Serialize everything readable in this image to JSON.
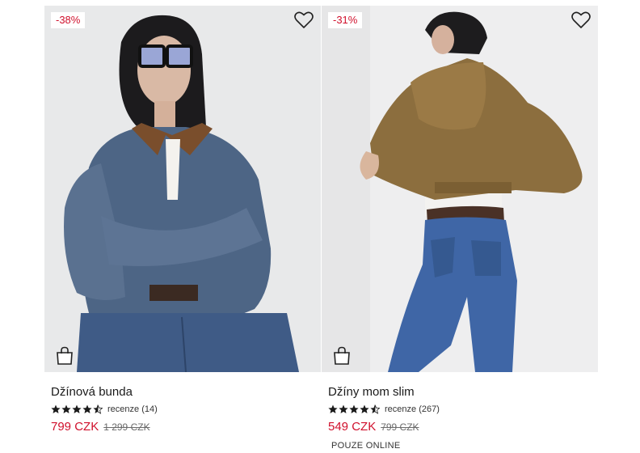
{
  "products": [
    {
      "discount": "-38%",
      "title": "Džínová bunda",
      "rating": 4.5,
      "reviews": "recenze (14)",
      "price_now": "799 CZK",
      "price_old": "1 299 CZK",
      "badge": ""
    },
    {
      "discount": "-31%",
      "title": "Džíny mom slim",
      "rating": 4.5,
      "reviews": "recenze (267)",
      "price_now": "549 CZK",
      "price_old": "799 CZK",
      "badge": "POUZE ONLINE"
    }
  ],
  "icons": {
    "favorite": "heart-outline-icon",
    "cart": "shopping-bag-icon",
    "rating": "star-icon"
  },
  "colors": {
    "sale_red": "#d0102c",
    "text": "#1a1a1a",
    "photo_bg": "#e9eaec"
  }
}
